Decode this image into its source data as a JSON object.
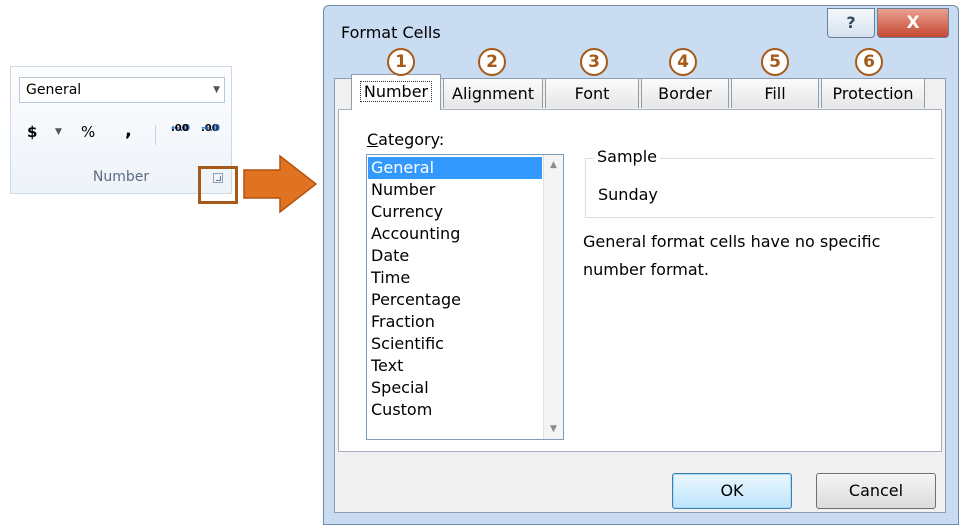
{
  "ribbon": {
    "number_format": "General",
    "currency_symbol": "$",
    "percent_symbol": "%",
    "comma_symbol": ",",
    "increase_decimal": ".00",
    "decrease_decimal": ".0",
    "increase_decimal_prefix": "←.0",
    "decrease_decimal_prefix": "→.0",
    "group_label": "Number",
    "highlight_color": "#a55a1a",
    "arrow_color": "#e0731f"
  },
  "dialog": {
    "title": "Format Cells",
    "help_glyph": "?",
    "close_glyph": "X",
    "tabs": [
      {
        "label": "Number",
        "badge": "1"
      },
      {
        "label": "Alignment",
        "badge": "2"
      },
      {
        "label": "Font",
        "badge": "3"
      },
      {
        "label": "Border",
        "badge": "4"
      },
      {
        "label": "Fill",
        "badge": "5"
      },
      {
        "label": "Protection",
        "badge": "6"
      }
    ],
    "category_label_first": "C",
    "category_label_rest": "ategory:",
    "categories": [
      "General",
      "Number",
      "Currency",
      "Accounting",
      "Date",
      "Time",
      "Percentage",
      "Fraction",
      "Scientific",
      "Text",
      "Special",
      "Custom"
    ],
    "selected_category": "General",
    "sample_label": "Sample",
    "sample_value": "Sunday",
    "description": "General format cells have no specific number format.",
    "ok_label": "OK",
    "cancel_label": "Cancel"
  }
}
